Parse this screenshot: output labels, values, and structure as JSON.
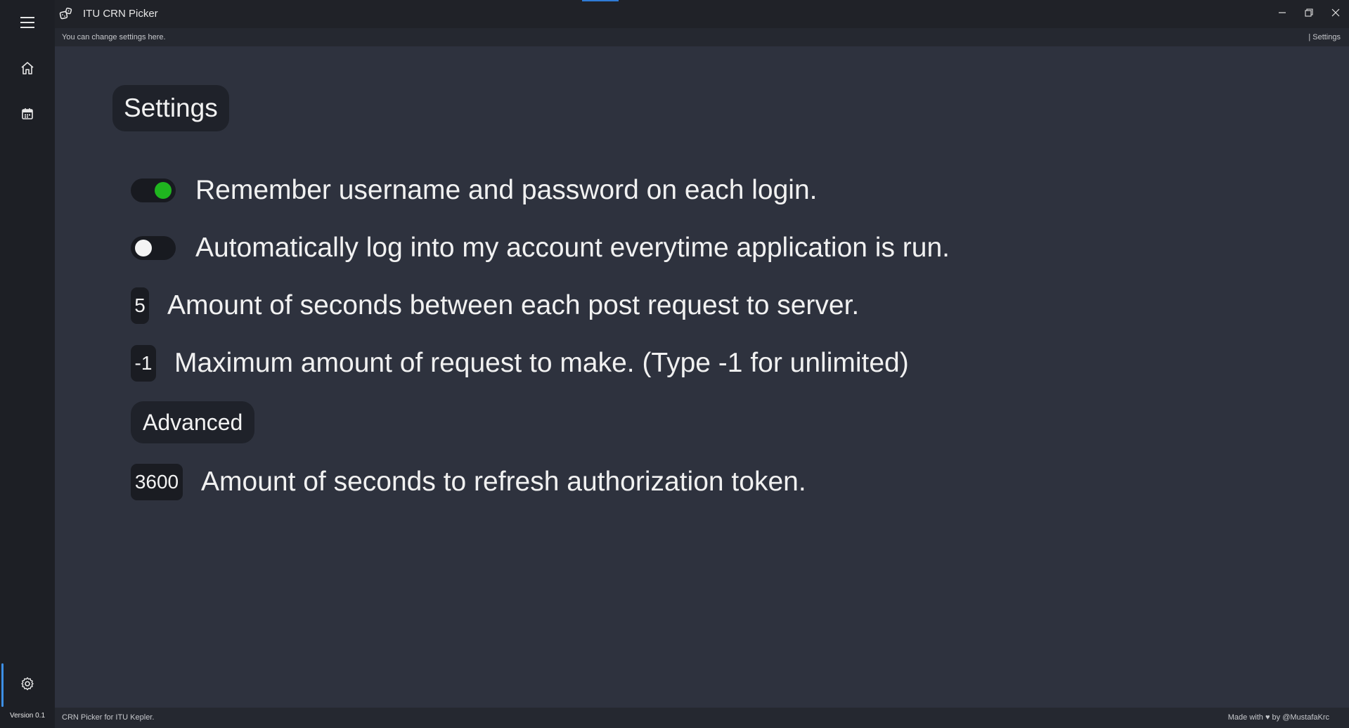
{
  "window": {
    "title": "ITU CRN Picker",
    "app_icon": "dice-icon"
  },
  "subheader": {
    "hint": "You can change settings here.",
    "breadcrumb": "| Settings"
  },
  "sidebar": {
    "items": [
      {
        "name": "menu",
        "icon": "hamburger-menu-icon"
      },
      {
        "name": "home",
        "icon": "home-icon"
      },
      {
        "name": "calendar",
        "icon": "calendar-icon"
      },
      {
        "name": "settings",
        "icon": "gear-icon",
        "selected": true
      }
    ],
    "version": "Version 0.1"
  },
  "main": {
    "title": "Settings",
    "settings": {
      "remember": {
        "enabled": true,
        "label": "Remember username and password on each login."
      },
      "autologin": {
        "enabled": false,
        "label": "Automatically log into my account everytime application is run."
      },
      "delay": {
        "value": "5",
        "label": "Amount of seconds between each post request to server."
      },
      "max_requests": {
        "value": "-1",
        "label": "Maximum amount of request to make. (Type -1 for unlimited)"
      }
    },
    "advanced": {
      "title": "Advanced",
      "token_refresh": {
        "value": "3600",
        "label": "Amount of seconds to refresh authorization token."
      }
    }
  },
  "footer": {
    "left": "CRN Picker for ITU Kepler.",
    "right": "Made with ♥ by @MustafaKrc"
  },
  "colors": {
    "toggle_on": "#1fb51f",
    "accent": "#3d8fe6",
    "background": "#2e323e"
  }
}
